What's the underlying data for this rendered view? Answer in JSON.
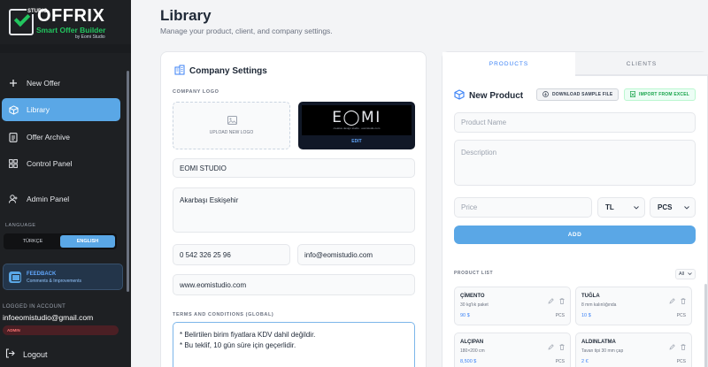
{
  "app": {
    "logo_studio": "STUDIO",
    "logo_title": "OFFRIX",
    "logo_subtitle": "Smart Offer Builder",
    "logo_by": "by Eomi Studio"
  },
  "sidebar": {
    "items": [
      {
        "label": "New Offer",
        "icon": "plus-icon"
      },
      {
        "label": "Library",
        "icon": "box-icon",
        "active": true
      },
      {
        "label": "Offer Archive",
        "icon": "document-icon"
      },
      {
        "label": "Control Panel",
        "icon": "grid-icon"
      },
      {
        "label": "Admin Panel",
        "icon": "user-icon"
      }
    ],
    "language_label": "LANGUAGE",
    "languages": [
      "TÜRKÇE",
      "ENGLISH"
    ],
    "selected_language": "ENGLISH",
    "feedback": {
      "title": "FEEDBACK",
      "subtitle": "Comments & Improvements"
    },
    "logged_label": "LOGGED IN ACCOUNT",
    "email": "infoeomistudio@gmail.com",
    "role": "ADMIN",
    "logout": "Logout"
  },
  "header": {
    "title": "Library",
    "subtitle": "Manage your product, client, and company settings."
  },
  "company": {
    "title": "Company Settings",
    "logo_label": "COMPANY LOGO",
    "upload_label": "UPLOAD NEW LOGO",
    "preview_logo_text": "E◯MI",
    "preview_tagline": "creative design studio · eomistudio.com",
    "edit_label": "EDIT",
    "name": "EOMI STUDIO",
    "address": "Akarbaşı Eskişehir",
    "phone": "0 542 326 25 96",
    "email": "info@eomistudio.com",
    "website": "www.eomistudio.com",
    "terms_label": "TERMS AND CONDITIONS (GLOBAL)",
    "terms_line1": "* Belirtilen birim fiyatlara KDV dahil değildir.",
    "terms_line2": "* Bu teklif, 10 gün süre için geçerlidir."
  },
  "products": {
    "tabs": [
      "PRODUCTS",
      "CLIENTS"
    ],
    "active_tab": "PRODUCTS",
    "new_title": "New Product",
    "download_btn": "DOWNLOAD SAMPLE FILE",
    "import_btn": "IMPORT FROM EXCEL",
    "name_placeholder": "Product Name",
    "desc_placeholder": "Description",
    "price_placeholder": "Price",
    "currency": "TL",
    "unit": "PCS",
    "add_btn": "ADD",
    "list_label": "PRODUCT LIST",
    "filter": "All",
    "list": [
      {
        "name": "ÇİMENTO",
        "desc": "30 kg'lık paket",
        "price": "90 $",
        "unit": "PCS"
      },
      {
        "name": "TUĞLA",
        "desc": "8 mm kalınlığında",
        "price": "10 $",
        "unit": "PCS"
      },
      {
        "name": "ALÇIPAN",
        "desc": "180×200 cm",
        "price": "8,500 $",
        "unit": "PCS"
      },
      {
        "name": "ALDINLATMA",
        "desc": "Tavan tipi 30 mm çap",
        "price": "2 €",
        "unit": "PCS"
      }
    ]
  },
  "colors": {
    "accent": "#5aa7e6",
    "sidebar_bg": "#1e2023",
    "brand_green": "#22c55e"
  }
}
